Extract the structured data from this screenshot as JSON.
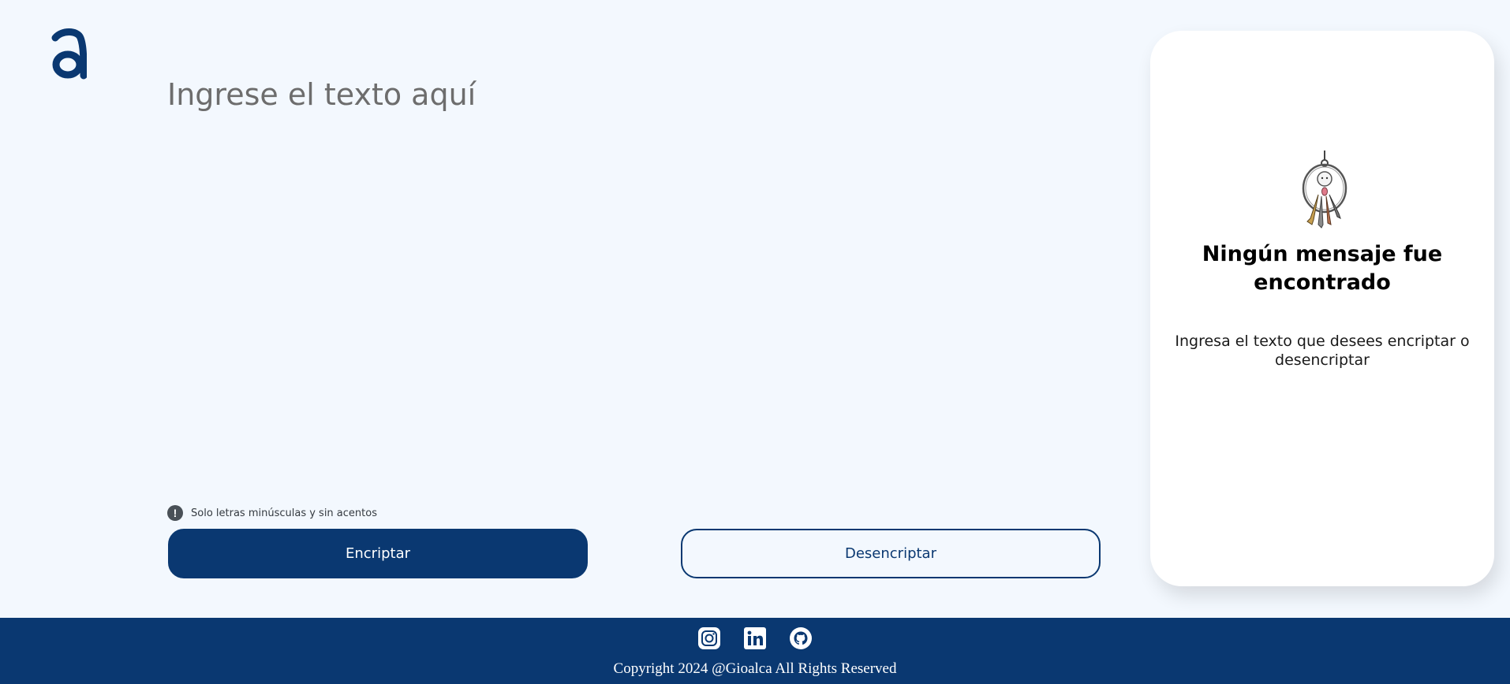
{
  "input": {
    "placeholder": "Ingrese el texto aquí",
    "value": ""
  },
  "hint": {
    "icon": "exclamation-circle-icon",
    "text": "Solo letras minúsculas y sin acentos"
  },
  "buttons": {
    "encrypt_label": "Encriptar",
    "decrypt_label": "Desencriptar"
  },
  "output_card": {
    "image_icon": "keys-illustration",
    "title": "Ningún mensaje fue encontrado",
    "text": "Ingresa el texto que desees encriptar o desencriptar"
  },
  "footer": {
    "social": [
      {
        "name": "instagram-icon"
      },
      {
        "name": "linkedin-icon"
      },
      {
        "name": "github-icon"
      }
    ],
    "copyright": "Copyright 2024 @Gioalca All Rights Reserved"
  },
  "colors": {
    "background": "#f3f8fe",
    "primary": "#0a3871",
    "card": "#ffffff",
    "placeholder": "#6d6d6d"
  }
}
